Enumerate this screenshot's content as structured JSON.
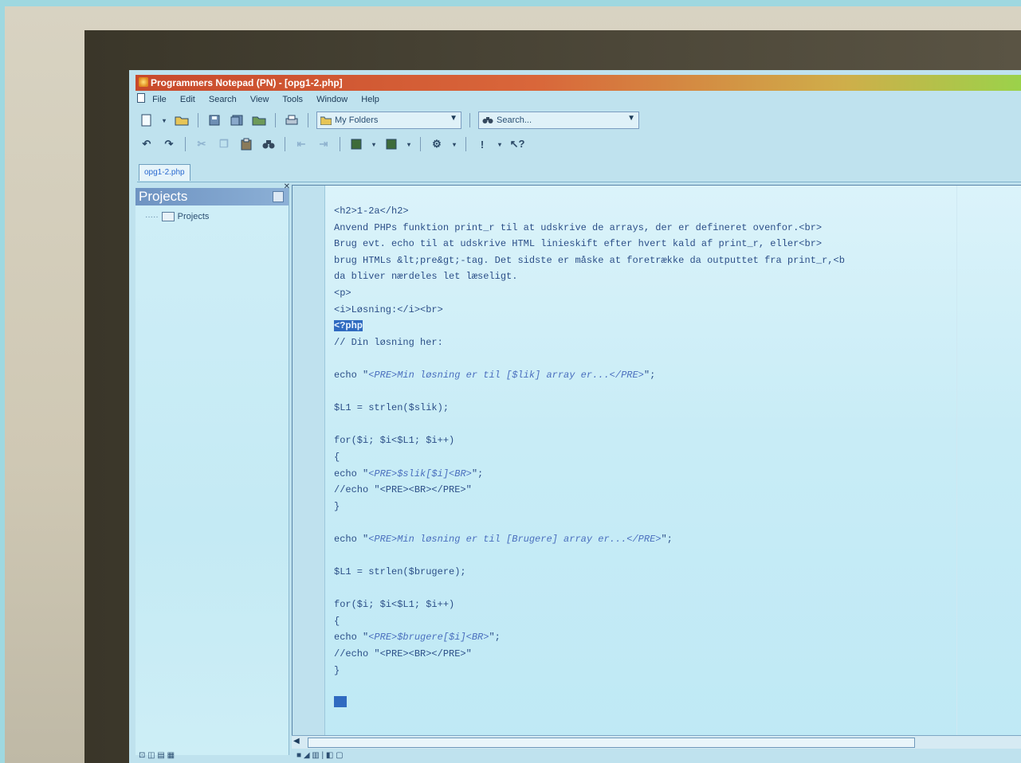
{
  "window": {
    "title": "Programmers Notepad (PN) - [opg1-2.php]"
  },
  "menu": {
    "items": [
      "File",
      "Edit",
      "Search",
      "View",
      "Tools",
      "Window",
      "Help"
    ]
  },
  "toolbar": {
    "folders_combo": "My Folders",
    "search_combo": "Search..."
  },
  "tabs": [
    {
      "label": "opg1-2.php",
      "active": true
    }
  ],
  "projects_panel": {
    "title": "Projects",
    "tree_root": "Projects"
  },
  "editor": {
    "lines": [
      [
        {
          "t": "<h2>1-2a</h2>"
        }
      ],
      [
        {
          "t": "Anvend PHPs funktion print_r til at udskrive de arrays, der er defineret ovenfor.<br>"
        }
      ],
      [
        {
          "t": "Brug evt. echo til at udskrive HTML linieskift efter hvert kald af print_r, eller<br>"
        }
      ],
      [
        {
          "t": "brug HTMLs &lt;pre&gt;-tag. Det sidste er måske at foretrække da outputtet fra print_r,<b"
        }
      ],
      [
        {
          "t": "da bliver nærdeles let læseligt."
        }
      ],
      [
        {
          "t": "<p>"
        }
      ],
      [
        {
          "t": "<i>Løsning:</i><br>"
        }
      ],
      [
        {
          "t": "<?php",
          "c": "php"
        }
      ],
      [
        {
          "t": "// Din løsning her:"
        }
      ],
      [
        {
          "t": ""
        }
      ],
      [
        {
          "t": "echo \""
        },
        {
          "t": "<PRE>Min løsning er til [$lik] array er...</PRE>",
          "c": "str"
        },
        {
          "t": "\";"
        }
      ],
      [
        {
          "t": ""
        }
      ],
      [
        {
          "t": "$L1 = strlen($slik);"
        }
      ],
      [
        {
          "t": ""
        }
      ],
      [
        {
          "t": "for($i; $i<$L1; $i++)"
        }
      ],
      [
        {
          "t": "{"
        }
      ],
      [
        {
          "t": "echo \""
        },
        {
          "t": "<PRE>$slik[$i]<BR>",
          "c": "str"
        },
        {
          "t": "\";"
        }
      ],
      [
        {
          "t": "//echo \"<PRE><BR></PRE>\""
        }
      ],
      [
        {
          "t": "}"
        }
      ],
      [
        {
          "t": ""
        }
      ],
      [
        {
          "t": "echo \""
        },
        {
          "t": "<PRE>Min løsning er til [Brugere] array er...</PRE>",
          "c": "str"
        },
        {
          "t": "\";"
        }
      ],
      [
        {
          "t": ""
        }
      ],
      [
        {
          "t": "$L1 = strlen($brugere);"
        }
      ],
      [
        {
          "t": ""
        }
      ],
      [
        {
          "t": "for($i; $i<$L1; $i++)"
        }
      ],
      [
        {
          "t": "{"
        }
      ],
      [
        {
          "t": "echo \""
        },
        {
          "t": "<PRE>$brugere[$i]<BR>",
          "c": "str"
        },
        {
          "t": "\";"
        }
      ],
      [
        {
          "t": "//echo \"<PRE><BR></PRE>\""
        }
      ],
      [
        {
          "t": "}"
        }
      ],
      [
        {
          "t": ""
        }
      ],
      [
        {
          "t": "?>",
          "c": "caretline"
        }
      ]
    ]
  },
  "colors": {
    "titlebar_start": "#c84a2c",
    "titlebar_end": "#9bd24a",
    "editor_bg": "#c8ecf6",
    "code_text": "#2c4f88",
    "php_tag_highlight": "#2f6ac0"
  }
}
